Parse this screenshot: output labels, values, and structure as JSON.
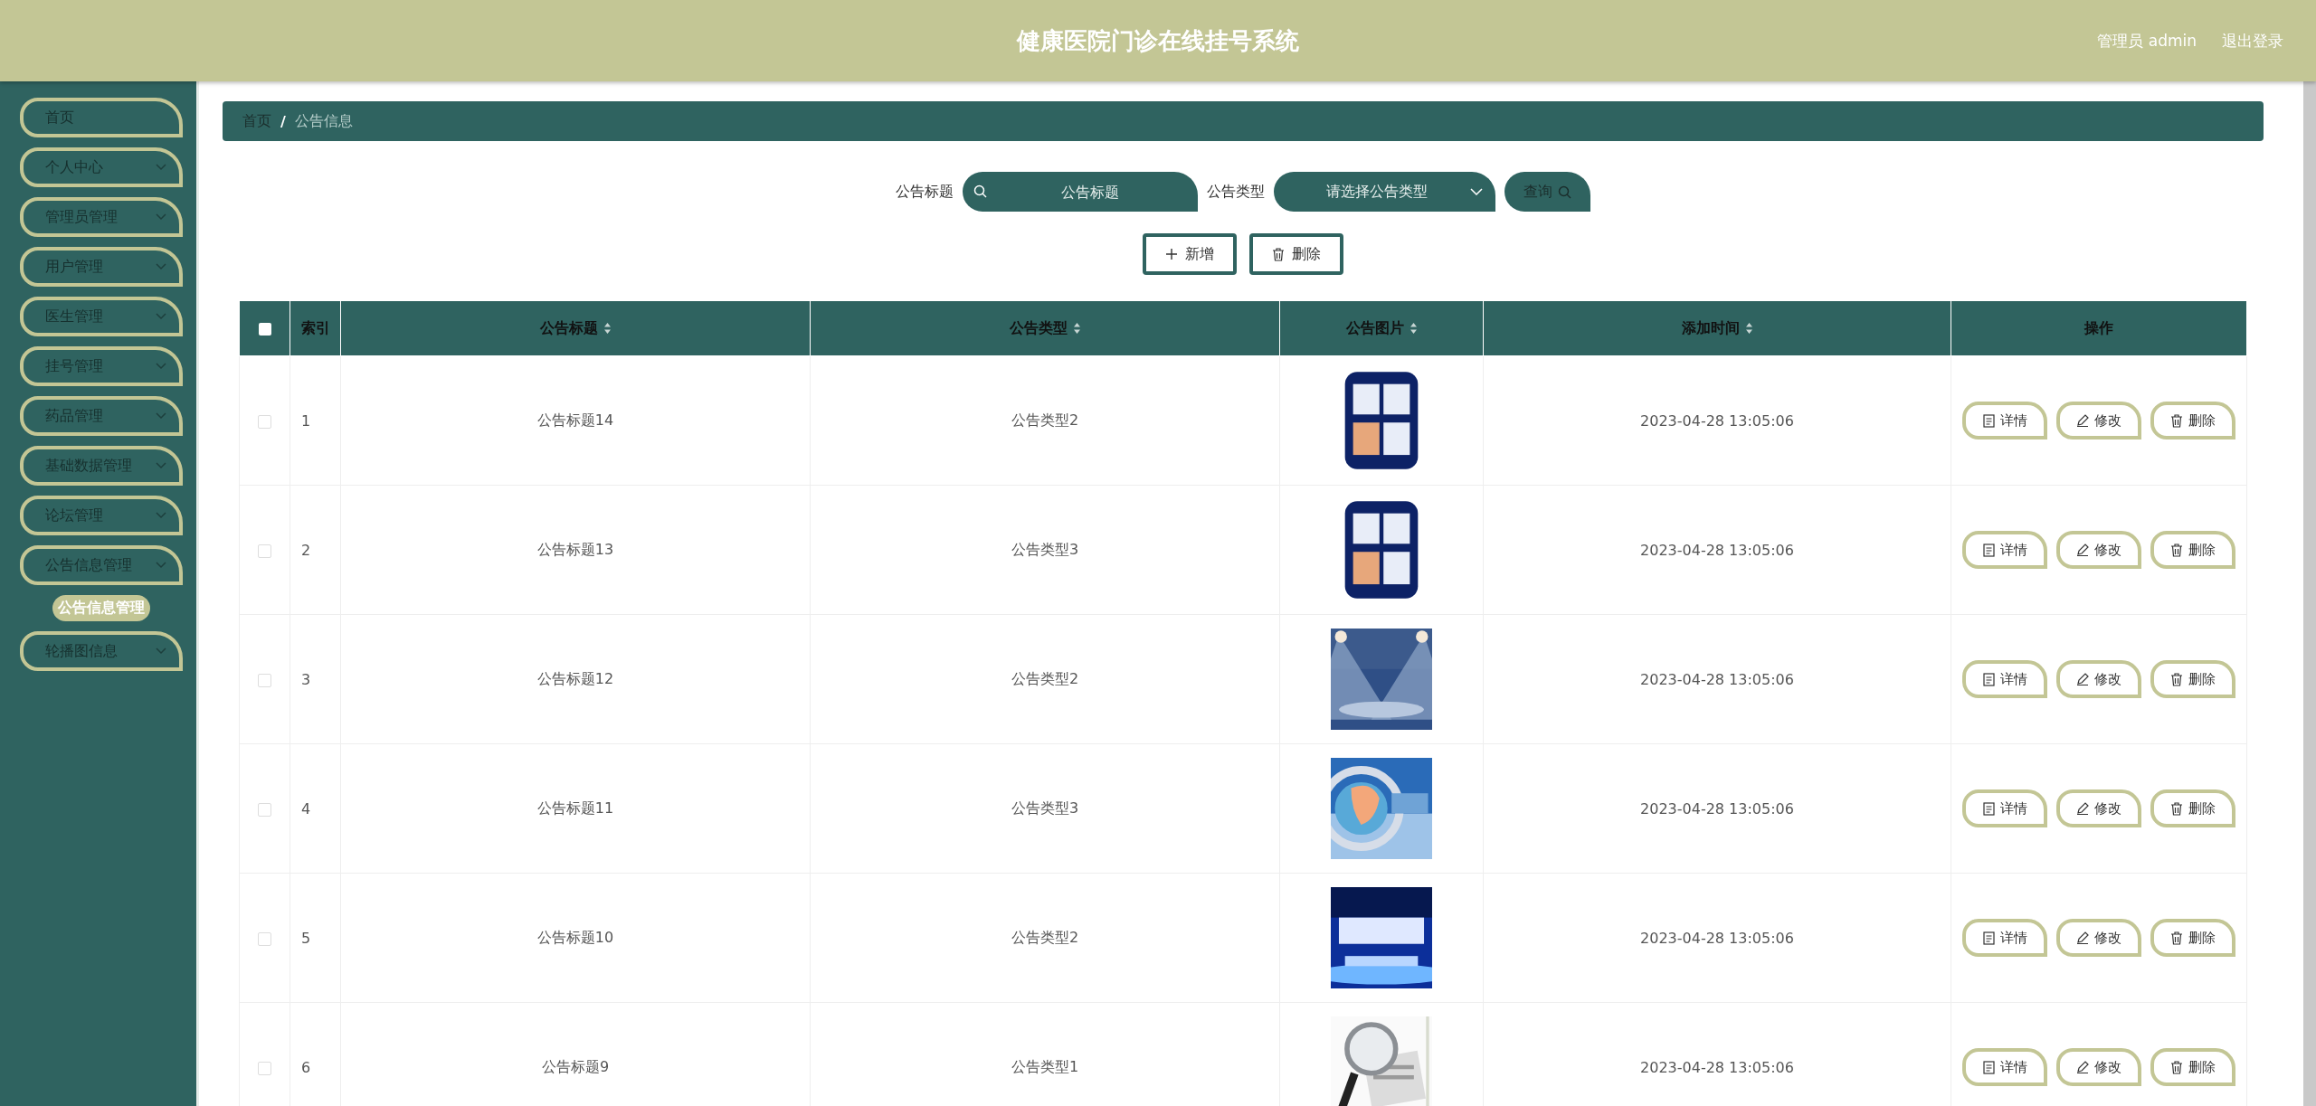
{
  "header": {
    "title": "健康医院门诊在线挂号系统",
    "user": "管理员 admin",
    "logout": "退出登录"
  },
  "sidebar": {
    "items": [
      {
        "label": "首页",
        "kind": "link"
      },
      {
        "label": "个人中心",
        "kind": "menu"
      },
      {
        "label": "管理员管理",
        "kind": "menu"
      },
      {
        "label": "用户管理",
        "kind": "menu"
      },
      {
        "label": "医生管理",
        "kind": "menu"
      },
      {
        "label": "挂号管理",
        "kind": "menu"
      },
      {
        "label": "药品管理",
        "kind": "menu"
      },
      {
        "label": "基础数据管理",
        "kind": "menu"
      },
      {
        "label": "论坛管理",
        "kind": "menu"
      },
      {
        "label": "公告信息管理",
        "kind": "menu",
        "children": [
          {
            "label": "公告信息管理",
            "selected": true
          }
        ]
      },
      {
        "label": "轮播图信息",
        "kind": "menu"
      }
    ]
  },
  "breadcrumb": {
    "separator": "/",
    "items": [
      "首页",
      "公告信息"
    ]
  },
  "search": {
    "fields": [
      {
        "label": "公告标题",
        "kind": "text",
        "placeholder": "公告标题"
      },
      {
        "label": "公告类型",
        "kind": "select",
        "placeholder": "请选择公告类型"
      }
    ],
    "button": "查询"
  },
  "actions": [
    {
      "label": "新增",
      "kind": "add"
    },
    {
      "label": "删除",
      "kind": "delete"
    }
  ],
  "table": {
    "select_all": false,
    "columns": [
      {
        "label": "索引",
        "sortable": false
      },
      {
        "label": "公告标题",
        "sortable": true
      },
      {
        "label": "公告类型",
        "sortable": true
      },
      {
        "label": "公告图片",
        "sortable": true
      },
      {
        "label": "添加时间",
        "sortable": true
      },
      {
        "label": "操作",
        "sortable": false
      }
    ],
    "rows": [
      {
        "selected": false,
        "index": "1",
        "title": "公告标题14",
        "type": "公告类型2",
        "time": "2023-04-28 13:05:06",
        "actions": [
          {
            "label": "详情",
            "kind": "detail"
          },
          {
            "label": "修改",
            "kind": "edit"
          },
          {
            "label": "删除",
            "kind": "delete"
          }
        ]
      },
      {
        "selected": false,
        "index": "2",
        "title": "公告标题13",
        "type": "公告类型3",
        "time": "2023-04-28 13:05:06",
        "actions": [
          {
            "label": "详情",
            "kind": "detail"
          },
          {
            "label": "修改",
            "kind": "edit"
          },
          {
            "label": "删除",
            "kind": "delete"
          }
        ]
      },
      {
        "selected": false,
        "index": "3",
        "title": "公告标题12",
        "type": "公告类型2",
        "time": "2023-04-28 13:05:06",
        "actions": [
          {
            "label": "详情",
            "kind": "detail"
          },
          {
            "label": "修改",
            "kind": "edit"
          },
          {
            "label": "删除",
            "kind": "delete"
          }
        ]
      },
      {
        "selected": false,
        "index": "4",
        "title": "公告标题11",
        "type": "公告类型3",
        "time": "2023-04-28 13:05:06",
        "actions": [
          {
            "label": "详情",
            "kind": "detail"
          },
          {
            "label": "修改",
            "kind": "edit"
          },
          {
            "label": "删除",
            "kind": "delete"
          }
        ]
      },
      {
        "selected": false,
        "index": "5",
        "title": "公告标题10",
        "type": "公告类型2",
        "time": "2023-04-28 13:05:06",
        "actions": [
          {
            "label": "详情",
            "kind": "detail"
          },
          {
            "label": "修改",
            "kind": "edit"
          },
          {
            "label": "删除",
            "kind": "delete"
          }
        ]
      },
      {
        "selected": false,
        "index": "6",
        "title": "公告标题9",
        "type": "公告类型1",
        "time": "2023-04-28 13:05:06",
        "actions": [
          {
            "label": "详情",
            "kind": "detail"
          },
          {
            "label": "修改",
            "kind": "edit"
          },
          {
            "label": "删除",
            "kind": "delete"
          }
        ]
      }
    ]
  }
}
